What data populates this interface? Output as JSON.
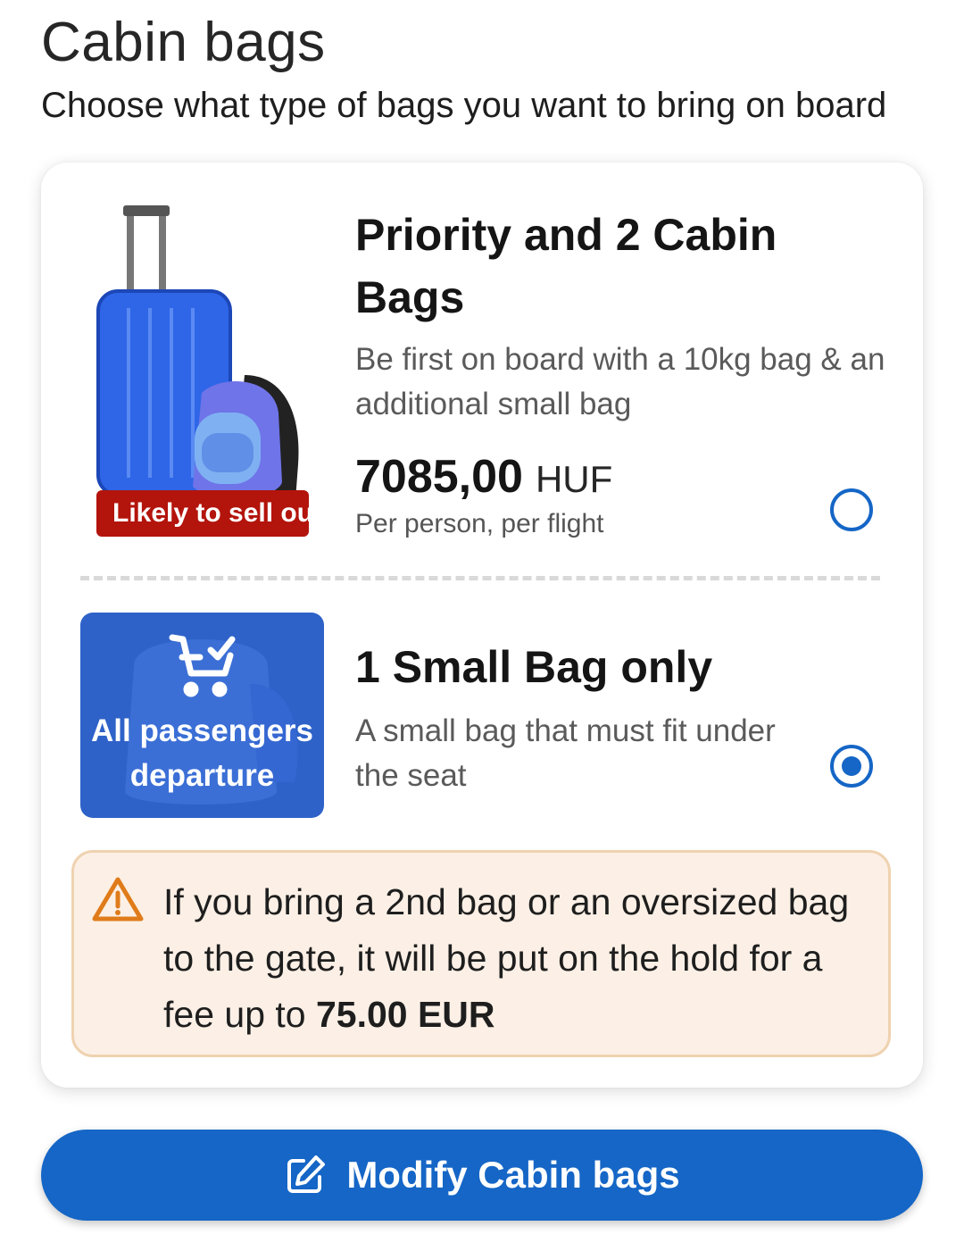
{
  "page": {
    "title": "Cabin bags",
    "subtitle": "Choose what type of bags you want to bring on board"
  },
  "options": [
    {
      "title": "Priority and 2 Cabin Bags",
      "description": "Be first on board with a 10kg bag & an additional small bag",
      "price": "7085,00",
      "currency": "HUF",
      "price_note": "Per person, per flight",
      "badge": "Likely to sell ou",
      "selected": false
    },
    {
      "title": "1 Small Bag only",
      "description": "A small bag that must fit under the seat",
      "image_overlay": "All passengers departure",
      "selected": true
    }
  ],
  "warning": {
    "text": "If you bring a 2nd bag or an oversized bag to the gate, it will be put on the hold for a fee up to ",
    "amount": "75.00 EUR"
  },
  "modify_button": {
    "label": "Modify Cabin bags"
  },
  "colors": {
    "primary": "#1566c6",
    "badge": "#b3140c",
    "warning_bg": "#fcf0e6",
    "warning_border": "#efd2b0",
    "warning_icon": "#e07b1a"
  },
  "icons": [
    "suitcase-backpack-image",
    "cart-check-icon",
    "warning-icon",
    "edit-icon"
  ]
}
